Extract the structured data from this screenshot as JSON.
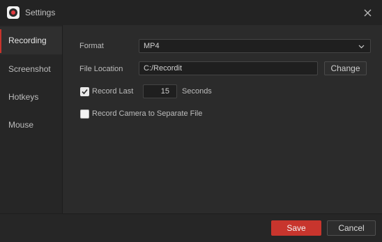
{
  "window": {
    "title": "Settings",
    "app_icon": "recordit-logo-icon",
    "close_icon": "close-icon"
  },
  "sidebar": {
    "items": [
      {
        "label": "Recording",
        "active": true
      },
      {
        "label": "Screenshot",
        "active": false
      },
      {
        "label": "Hotkeys",
        "active": false
      },
      {
        "label": "Mouse",
        "active": false
      }
    ]
  },
  "recording": {
    "format_label": "Format",
    "format_value": "MP4",
    "location_label": "File Location",
    "location_value": "C:/Recordit",
    "change_label": "Change",
    "record_last_label": "Record Last",
    "record_last_checked": true,
    "record_last_value": "15",
    "seconds_label": "Seconds",
    "camera_label": "Record Camera to Separate File",
    "camera_checked": false
  },
  "footer": {
    "save_label": "Save",
    "cancel_label": "Cancel"
  },
  "colors": {
    "accent": "#c8352d",
    "background": "#2b2b2b",
    "sidebar_bg": "#262626"
  }
}
